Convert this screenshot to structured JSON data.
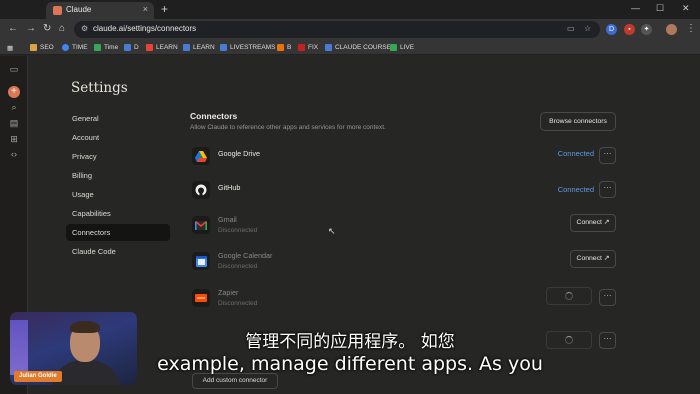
{
  "browser": {
    "tab_title": "Claude",
    "url": "claude.ai/settings/connectors",
    "tab_close": "×",
    "new_tab": "+"
  },
  "bookmarks": [
    {
      "label": "SEO",
      "color": "#d9a441"
    },
    {
      "label": "TIME",
      "color": "#4285f4"
    },
    {
      "label": "Time",
      "color": "#34a853"
    },
    {
      "label": "D",
      "color": "#4a7bd4"
    },
    {
      "label": "LEARN",
      "color": "#ea4335"
    },
    {
      "label": "LEARN",
      "color": "#4a7bd4"
    },
    {
      "label": "LIVESTREAMS",
      "color": "#4a7bd4"
    },
    {
      "label": "B",
      "color": "#e8710a"
    },
    {
      "label": "FIX",
      "color": "#c5221f"
    },
    {
      "label": "CLAUDE COURSE",
      "color": "#4a7bd4"
    },
    {
      "label": "LIVE",
      "color": "#34a853"
    }
  ],
  "settings": {
    "title": "Settings",
    "nav": [
      "General",
      "Account",
      "Privacy",
      "Billing",
      "Usage",
      "Capabilities",
      "Connectors",
      "Claude Code"
    ],
    "active": "Connectors"
  },
  "connectors": {
    "title": "Connectors",
    "description": "Allow Claude to reference other apps and services for more context.",
    "browse_label": "Browse connectors",
    "more_label": "···",
    "items": [
      {
        "name": "Google Drive",
        "status": "",
        "action": "Connected",
        "icon": "google-drive-icon",
        "color": "#34a853"
      },
      {
        "name": "GitHub",
        "status": "",
        "action": "Connected",
        "icon": "github-icon",
        "color": "#e8e8e8"
      },
      {
        "name": "Gmail",
        "status": "Disconnected",
        "action": "Connect ↗",
        "icon": "gmail-icon",
        "color": "#ea4335"
      },
      {
        "name": "Google Calendar",
        "status": "Disconnected",
        "action": "Connect ↗",
        "icon": "google-calendar-icon",
        "color": "#4285f4"
      },
      {
        "name": "Zapier",
        "status": "Disconnected",
        "action": "",
        "icon": "zapier-icon",
        "color": "#ff4a00"
      }
    ],
    "add_custom_label": "Add custom connector"
  },
  "video": {
    "presenter_name": "Julian Goldie",
    "subtitle_cn": "管理不同的应用程序。 如您",
    "subtitle_en": "example, manage different apps. As you"
  }
}
